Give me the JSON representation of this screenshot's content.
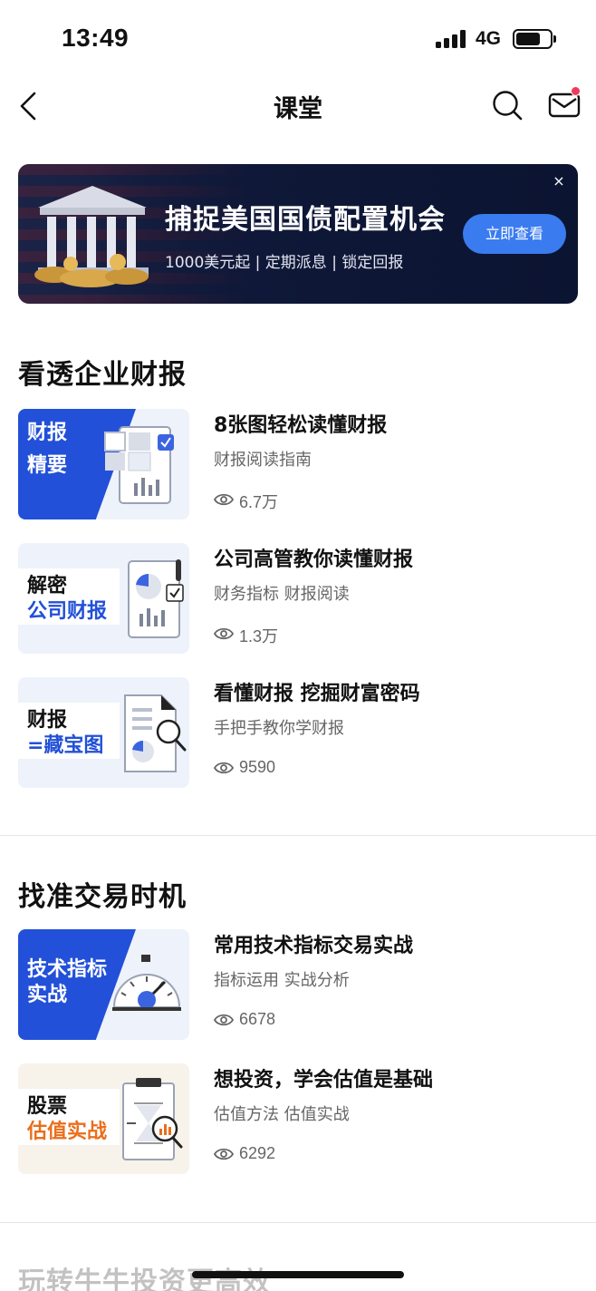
{
  "status_bar": {
    "time": "13:49",
    "network": "4G"
  },
  "nav": {
    "title": "课堂"
  },
  "banner": {
    "title": "捕捉美国国债配置机会",
    "subtitle": "1000美元起 | 定期派息 | 锁定回报",
    "cta": "立即查看",
    "close": "×"
  },
  "sections": [
    {
      "title": "看透企业财报",
      "courses": [
        {
          "thumb_line1": "财报",
          "thumb_line2": "精要",
          "title": "8张图轻松读懂财报",
          "subtitle": "财报阅读指南",
          "views": "6.7万"
        },
        {
          "thumb_line1": "解密",
          "thumb_line2": "公司财报",
          "title": "公司高管教你读懂财报",
          "subtitle": "财务指标 财报阅读",
          "views": "1.3万"
        },
        {
          "thumb_line1": "财报",
          "thumb_line2": "=藏宝图",
          "title": "看懂财报 挖掘财富密码",
          "subtitle": "手把手教你学财报",
          "views": "9590"
        }
      ]
    },
    {
      "title": "找准交易时机",
      "courses": [
        {
          "thumb_line1": "技术指标",
          "thumb_line2": "实战",
          "title": "常用技术指标交易实战",
          "subtitle": "指标运用 实战分析",
          "views": "6678"
        },
        {
          "thumb_line1": "股票",
          "thumb_line2": "估值实战",
          "title": "想投资，学会估值是基础",
          "subtitle": "估值方法 估值实战",
          "views": "6292"
        }
      ]
    },
    {
      "title": "玩转牛牛投资更高效"
    }
  ],
  "colors": {
    "accent": "#2250d8",
    "cta": "#3b7bf0",
    "badge": "#f0395b",
    "orange": "#ea6e1b"
  }
}
